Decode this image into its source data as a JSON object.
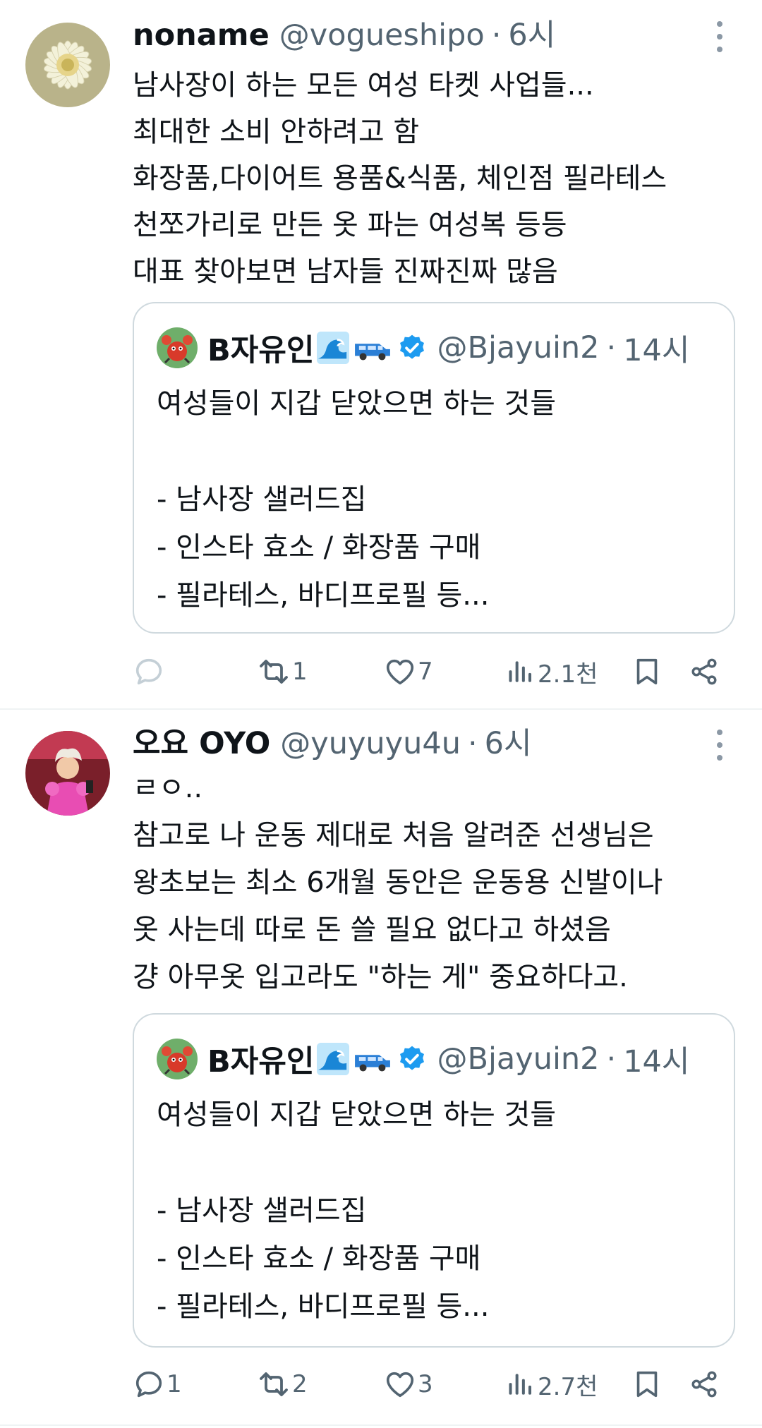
{
  "tweets": [
    {
      "author_name": "noname",
      "handle": "@vogueshipo",
      "separator": "·",
      "time": "6시",
      "avatar_icon": "white-flower-avatar",
      "body_lines": [
        "남사장이 하는 모든 여성 타켓 사업들...",
        "최대한 소비 안하려고 함",
        "화장품,다이어트 용품&식품, 체인점 필라테스",
        "천쪼가리로 만든 옷 파는 여성복 등등",
        "대표 찾아보면 남자들 진짜진짜 많음"
      ],
      "quote": {
        "author_name": "B자유인",
        "emojis": [
          "wave-emoji",
          "car-emoji"
        ],
        "verified": true,
        "handle": "@Bjayuin2",
        "separator": "·",
        "time": "14시",
        "lines": [
          "여성들이 지갑 닫았으면 하는 것들",
          "",
          "- 남사장 샐러드집",
          "- 인스타 효소 / 화장품 구매",
          "- 필라테스, 바디프로필 등..."
        ]
      },
      "actions": {
        "reply": "",
        "retweet": "1",
        "like": "7",
        "views": "2.1천"
      }
    },
    {
      "author_name": "오요 OYO",
      "handle": "@yuyuyu4u",
      "separator": "·",
      "time": "6시",
      "avatar_icon": "pink-dress-person-avatar",
      "body_lines": [
        "ㄹㅇ..",
        "참고로 나 운동 제대로 처음 알려준 선생님은",
        "왕초보는 최소 6개월 동안은 운동용 신발이나",
        "옷 사는데 따로 돈 쓸 필요 없다고 하셨음",
        "걍 아무옷 입고라도 \"하는 게\" 중요하다고."
      ],
      "quote": {
        "author_name": "B자유인",
        "emojis": [
          "wave-emoji",
          "car-emoji"
        ],
        "verified": true,
        "handle": "@Bjayuin2",
        "separator": "·",
        "time": "14시",
        "lines": [
          "여성들이 지갑 닫았으면 하는 것들",
          "",
          "- 남사장 샐러드집",
          "- 인스타 효소 / 화장품 구매",
          "- 필라테스, 바디프로필 등..."
        ]
      },
      "actions": {
        "reply": "1",
        "retweet": "2",
        "like": "3",
        "views": "2.7천"
      }
    }
  ],
  "colors": {
    "text": "#0f1419",
    "secondary": "#536471",
    "border": "#cfd9de",
    "verified": "#1d9bf0"
  }
}
